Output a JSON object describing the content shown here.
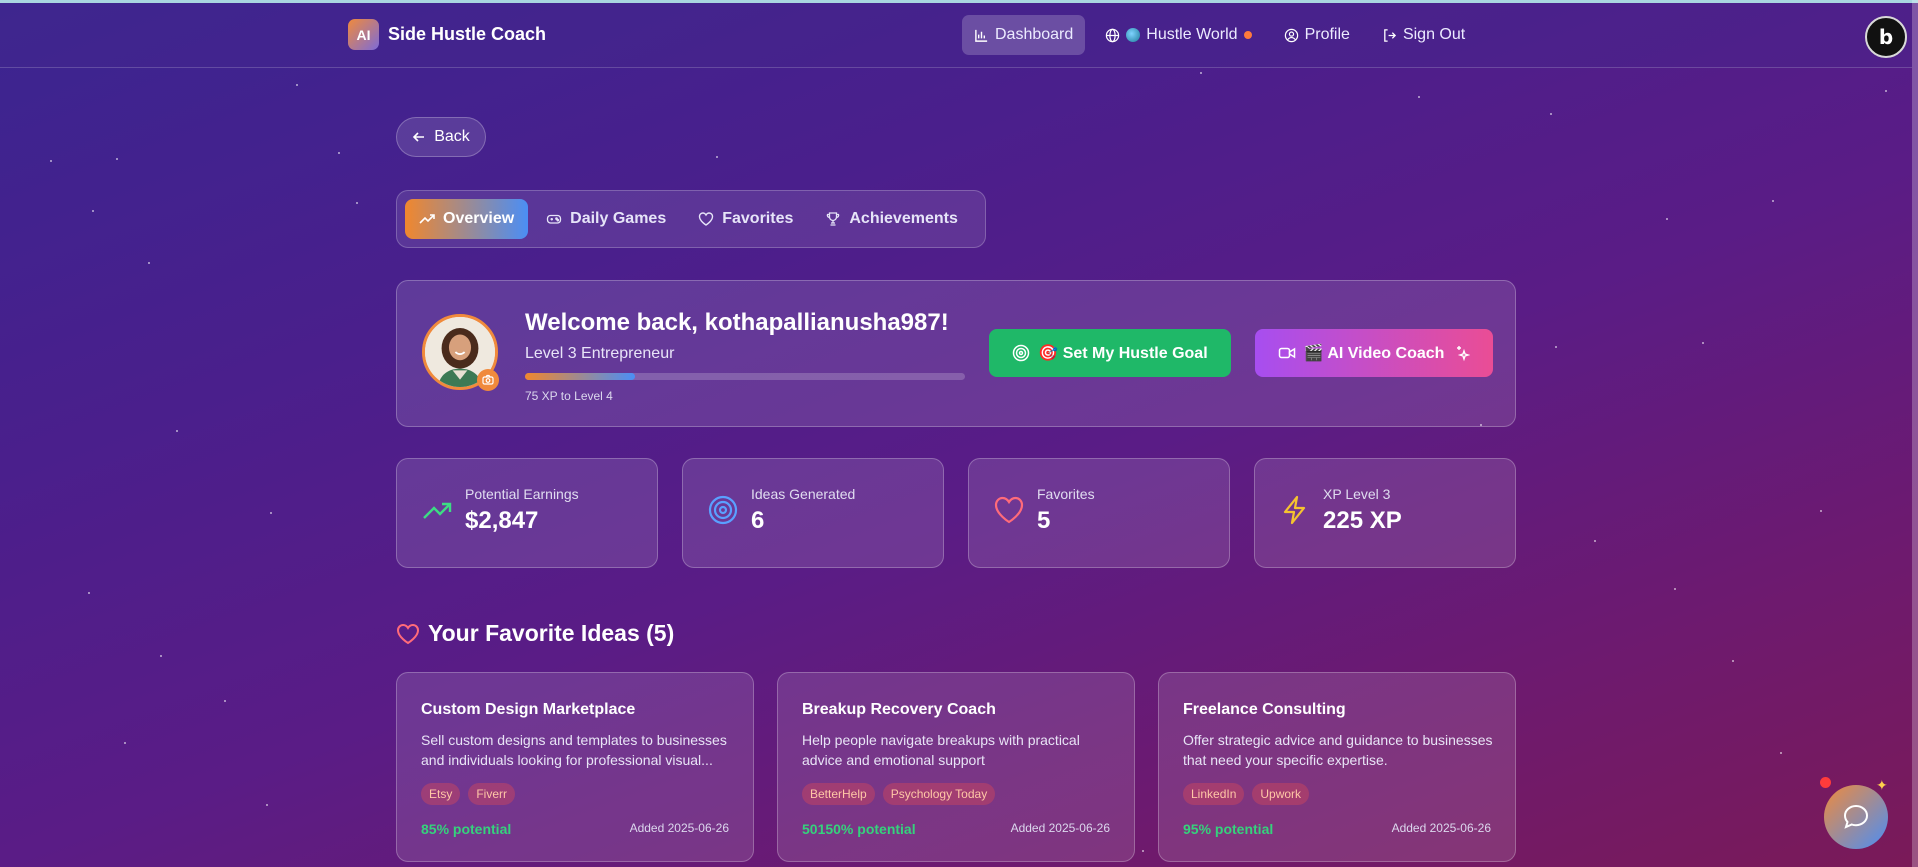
{
  "brand": {
    "logo_text": "AI",
    "name": "Side Hustle Coach"
  },
  "nav": {
    "dashboard": "Dashboard",
    "hustle_world": "Hustle World",
    "profile": "Profile",
    "sign_out": "Sign Out",
    "corner_badge": "b"
  },
  "back": {
    "label": "Back"
  },
  "tabs": [
    {
      "label": "Overview",
      "icon": "trending-up-icon",
      "active": true
    },
    {
      "label": "Daily Games",
      "icon": "gamepad-icon",
      "active": false
    },
    {
      "label": "Favorites",
      "icon": "heart-icon",
      "active": false
    },
    {
      "label": "Achievements",
      "icon": "trophy-icon",
      "active": false
    }
  ],
  "welcome": {
    "title": "Welcome back, kothapallianusha987!",
    "level": "Level 3 Entrepreneur",
    "xp_progress_fraction": 0.25,
    "xp_text": "75 XP to Level 4",
    "goal_button": "🎯 Set My Hustle Goal",
    "video_button": "🎬 AI Video Coach"
  },
  "stats": [
    {
      "label": "Potential Earnings",
      "value": "$2,847",
      "icon": "trending-up-icon",
      "color": "#3ddc84"
    },
    {
      "label": "Ideas Generated",
      "value": "6",
      "icon": "target-icon",
      "color": "#5aa0ff"
    },
    {
      "label": "Favorites",
      "value": "5",
      "icon": "heart-icon",
      "color": "#ff6b7a"
    },
    {
      "label": "XP Level 3",
      "value": "225 XP",
      "icon": "zap-icon",
      "color": "#f5c330"
    }
  ],
  "favorites": {
    "title": "Your Favorite Ideas (5)",
    "cards": [
      {
        "title": "Custom Design Marketplace",
        "description": "Sell custom designs and templates to businesses and individuals looking for professional visual...",
        "tags": [
          "Etsy",
          "Fiverr"
        ],
        "potential": "85% potential",
        "added": "Added 2025-06-26"
      },
      {
        "title": "Breakup Recovery Coach",
        "description": "Help people navigate breakups with practical advice and emotional support",
        "tags": [
          "BetterHelp",
          "Psychology Today"
        ],
        "potential": "50150% potential",
        "added": "Added 2025-06-26"
      },
      {
        "title": "Freelance Consulting",
        "description": "Offer strategic advice and guidance to businesses that need your specific expertise.",
        "tags": [
          "LinkedIn",
          "Upwork"
        ],
        "potential": "95% potential",
        "added": "Added 2025-06-26"
      }
    ]
  },
  "colors": {
    "accent_orange": "#f0872e",
    "accent_blue": "#4b8ef5",
    "success_green": "#1fb868",
    "potential_green": "#35d27c"
  }
}
